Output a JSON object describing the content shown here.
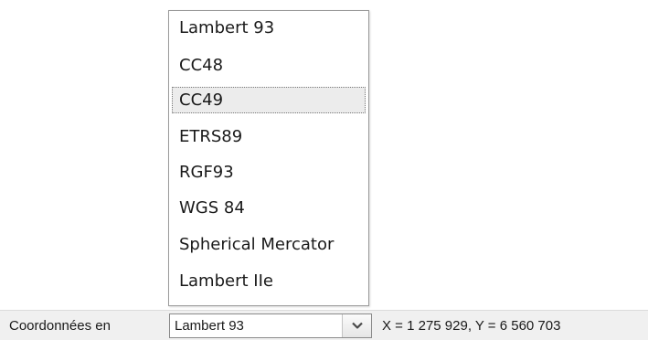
{
  "projection_dropdown": {
    "items": [
      {
        "label": "Lambert 93"
      },
      {
        "label": "CC48"
      },
      {
        "label": "CC49"
      },
      {
        "label": "ETRS89"
      },
      {
        "label": "RGF93"
      },
      {
        "label": "WGS 84"
      },
      {
        "label": "Spherical Mercator"
      },
      {
        "label": "Lambert IIe"
      }
    ],
    "highlighted_item": "CC49"
  },
  "status_bar": {
    "coord_label": "Coordonnées en",
    "selected_projection": "Lambert 93",
    "combo_icon": "chevron-down-icon",
    "coordinates": "X = 1 275 929, Y = 6 560 703"
  }
}
